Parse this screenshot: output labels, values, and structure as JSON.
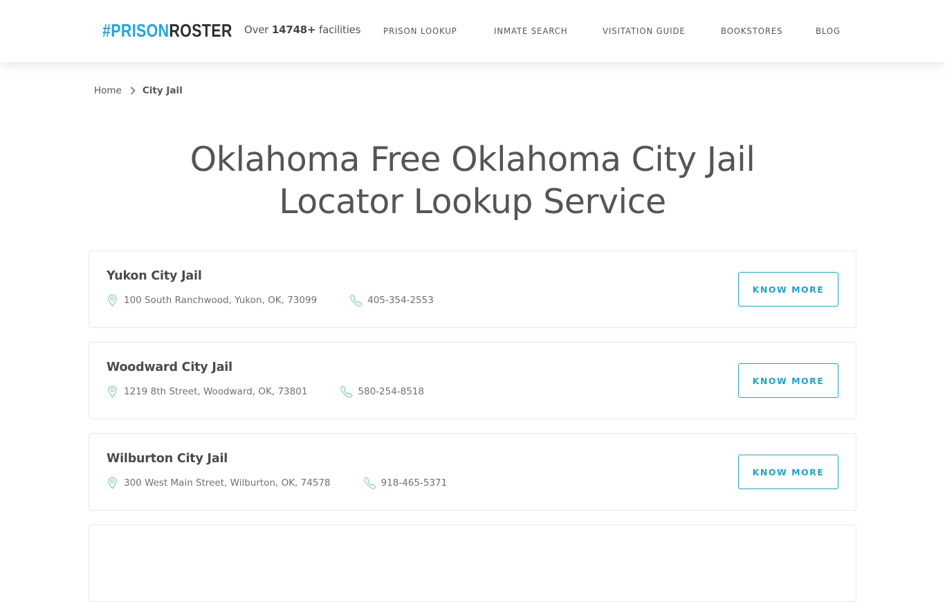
{
  "header": {
    "logo": {
      "hash": "#",
      "prison": "PRISON",
      "roster": "ROSTER"
    },
    "facilities": {
      "prefix": "Over ",
      "count": "14748+",
      "suffix": " facilities"
    },
    "nav": [
      {
        "label": "PRISON LOOKUP"
      },
      {
        "label": "INMATE SEARCH"
      },
      {
        "label": "VISITATION GUIDE"
      },
      {
        "label": "BOOKSTORES"
      },
      {
        "label": "BLOG"
      }
    ]
  },
  "breadcrumb": {
    "home": "Home",
    "current": "City Jail"
  },
  "page": {
    "title_line1": "Oklahoma Free Oklahoma City Jail",
    "title_line2": "Locator Lookup Service"
  },
  "colors": {
    "brand_blue": "#1ea7dd",
    "brand_dark": "#2a2d33",
    "button_accent": "#21a3c5",
    "icon_green": "#7fcf9c"
  },
  "facilities": [
    {
      "name": "Yukon City Jail",
      "address": "100 South Ranchwood, Yukon, OK, 73099",
      "phone": "405-354-2553",
      "button": "KNOW MORE"
    },
    {
      "name": "Woodward City Jail",
      "address": "1219 8th Street, Woodward, OK, 73801",
      "phone": "580-254-8518",
      "button": "KNOW MORE"
    },
    {
      "name": "Wilburton City Jail",
      "address": "300 West Main Street, Wilburton, OK, 74578",
      "phone": "918-465-5371",
      "button": "KNOW MORE"
    }
  ],
  "icons": {
    "location": "map-pin-icon",
    "phone": "phone-icon",
    "breadcrumb_separator": "chevron-right-icon"
  }
}
